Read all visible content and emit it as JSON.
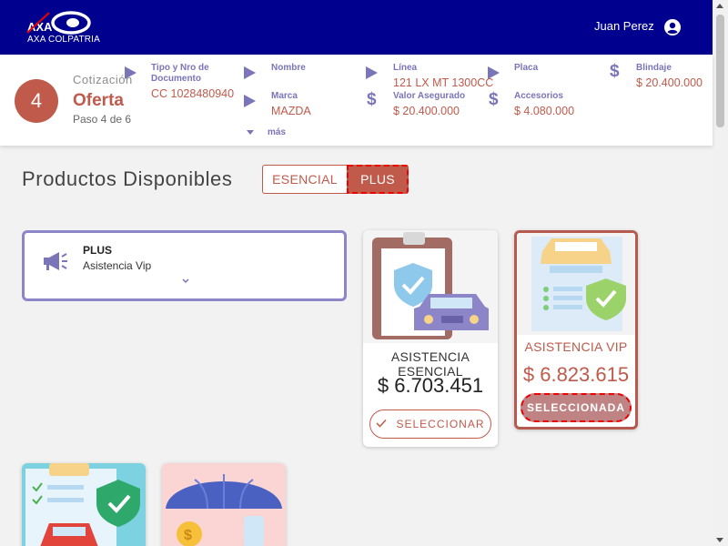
{
  "brand": {
    "logo_text": "AXA COLPATRIA"
  },
  "header": {
    "user_name": "Juan Perez",
    "user_icon": "user-circle-icon"
  },
  "summary": {
    "step_number": "4",
    "label": "Cotización",
    "title": "Oferta",
    "step_text": "Paso 4 de 6",
    "fields": {
      "documento_label": "Tipo y Nro de Documento",
      "documento_value": "CC 1028480940",
      "nombre_label": "Nombre",
      "nombre_value": "",
      "marca_label": "Marca",
      "marca_value": "MAZDA",
      "linea_label": "Línea",
      "linea_value": "121 LX MT 1300CC",
      "valor_label": "Valor Asegurado",
      "valor_value": "$ 20.400.000",
      "placa_label": "Placa",
      "placa_value": "",
      "accesorios_label": "Accesorios",
      "accesorios_value": "$ 4.080.000",
      "blindaje_label": "Blindaje",
      "blindaje_value": "$ 20.400.000"
    },
    "more_label": "más"
  },
  "products": {
    "title": "Productos Disponibles",
    "tabs": [
      {
        "label": "ESENCIAL",
        "active": false
      },
      {
        "label": "PLUS",
        "active": true
      }
    ],
    "plan_panel": {
      "name": "PLUS",
      "subtitle": "Asistencia Vip"
    },
    "cards": [
      {
        "title": "ASISTENCIA ESENCIAL",
        "price": "$ 6.703.451",
        "button": "SELECCIONAR",
        "selected": false
      },
      {
        "title": "ASISTENCIA VIP",
        "price": "$ 6.823.615",
        "button": "SELECCIONADA",
        "selected": true
      }
    ]
  },
  "colors": {
    "brand_blue": "#00008f",
    "accent": "#c05a4b",
    "label_purple": "#7a74b8",
    "selected_button": "#c08384"
  }
}
